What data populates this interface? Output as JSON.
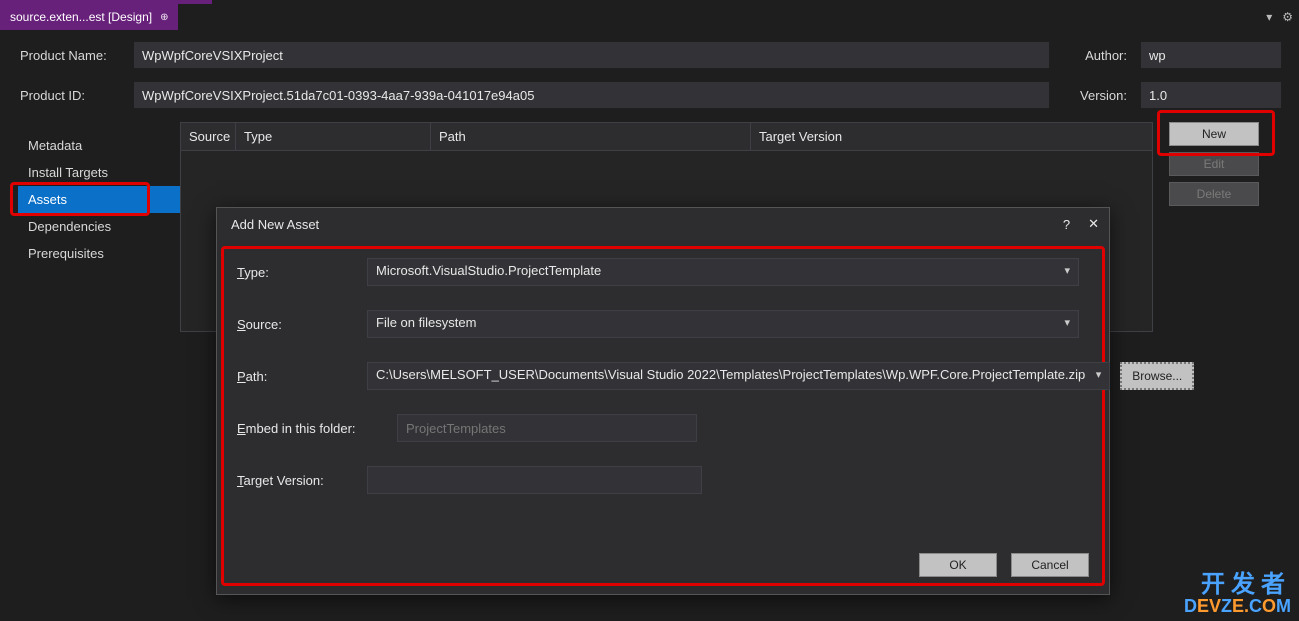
{
  "tab": {
    "title": "source.exten...est [Design]"
  },
  "form": {
    "productNameLabel": "Product Name:",
    "productName": "WpWpfCoreVSIXProject",
    "authorLabel": "Author:",
    "author": "wp",
    "productIdLabel": "Product ID:",
    "productId": "WpWpfCoreVSIXProject.51da7c01-0393-4aa7-939a-041017e94a05",
    "versionLabel": "Version:",
    "version": "1.0"
  },
  "sidebar": {
    "items": [
      "Metadata",
      "Install Targets",
      "Assets",
      "Dependencies",
      "Prerequisites"
    ],
    "selectedIndex": 2
  },
  "table": {
    "headers": [
      "Source",
      "Type",
      "Path",
      "Target Version"
    ]
  },
  "buttons": {
    "new": "New",
    "edit": "Edit",
    "delete": "Delete"
  },
  "dialog": {
    "title": "Add New Asset",
    "help": "?",
    "typeLabel": "Type:",
    "typeValue": "Microsoft.VisualStudio.ProjectTemplate",
    "sourceLabel": "Source:",
    "sourceValue": "File on filesystem",
    "pathLabel": "Path:",
    "pathValue": "C:\\Users\\MELSOFT_USER\\Documents\\Visual Studio 2022\\Templates\\ProjectTemplates\\Wp.WPF.Core.ProjectTemplate.zip",
    "browse": "Browse...",
    "embedLabel": "Embed in this folder:",
    "embedPlaceholder": "ProjectTemplates",
    "tvLabel": "Target Version:",
    "tvValue": "",
    "ok": "OK",
    "cancel": "Cancel"
  },
  "watermark": {
    "cn": "开发者",
    "en1": "D",
    "en2": "EV",
    "en3": "Z",
    "en4": "E.",
    "en5": "C",
    "en6": "O",
    "en7": "M"
  }
}
